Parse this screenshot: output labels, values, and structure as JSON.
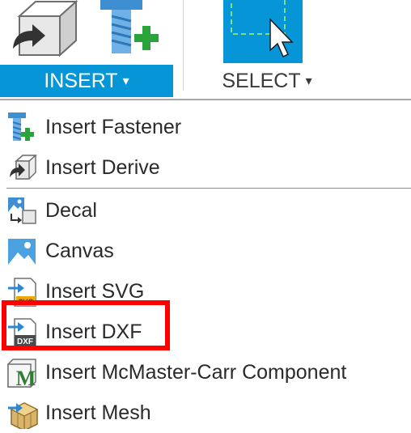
{
  "toolbar": {
    "insert_tab": {
      "label": "INSERT",
      "caret": "▾",
      "active": true
    },
    "select_tab": {
      "label": "SELECT",
      "caret": "▾",
      "active": false
    },
    "insert_icons": [
      "insert-derive-icon",
      "insert-fastener-icon"
    ],
    "select_icon": "select-cursor-icon",
    "accent_color": "#0696d7"
  },
  "menu": {
    "items": [
      {
        "label": "Insert Fastener",
        "icon": "fastener-icon"
      },
      {
        "label": "Insert Derive",
        "icon": "derive-icon"
      },
      {
        "label": "Decal",
        "icon": "decal-icon"
      },
      {
        "label": "Canvas",
        "icon": "canvas-icon"
      },
      {
        "label": "Insert SVG",
        "icon": "svg-file-icon"
      },
      {
        "label": "Insert DXF",
        "icon": "dxf-file-icon",
        "highlighted": true
      },
      {
        "label": "Insert McMaster-Carr Component",
        "icon": "mcmaster-icon"
      },
      {
        "label": "Insert Mesh",
        "icon": "mesh-icon"
      }
    ],
    "highlight_color": "#ff0000"
  }
}
